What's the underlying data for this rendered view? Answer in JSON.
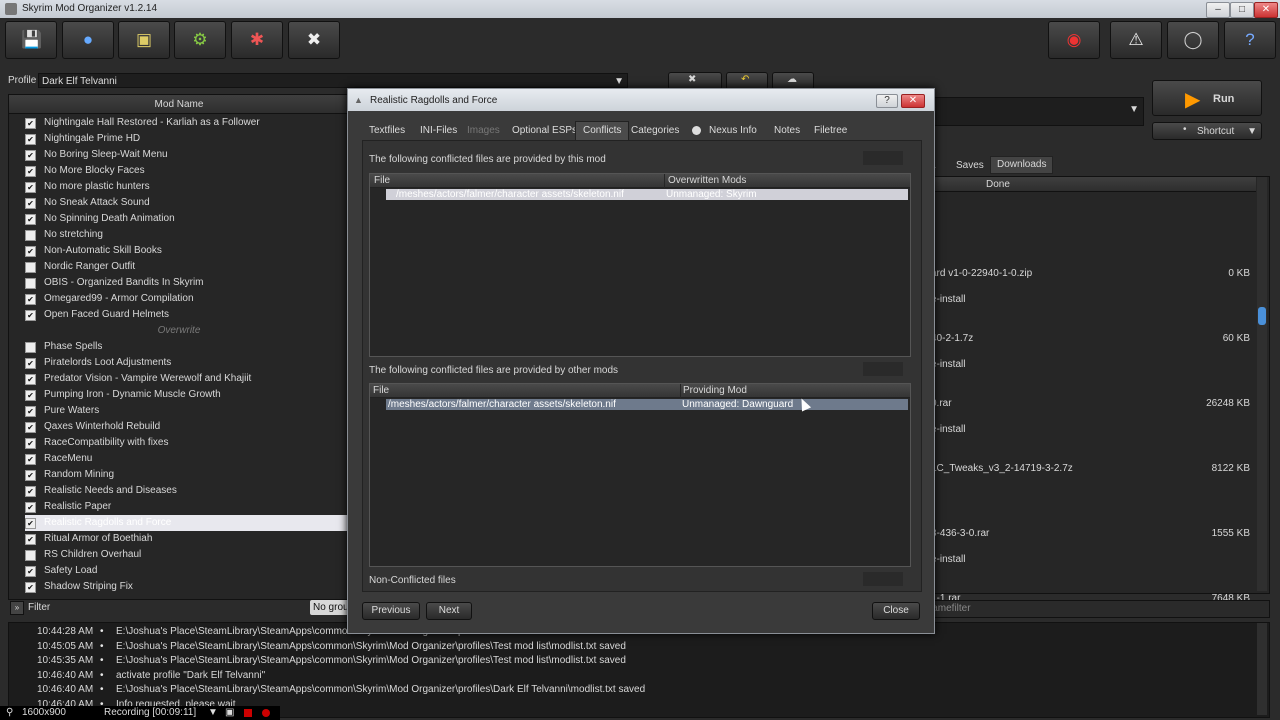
{
  "window": {
    "title": "Skyrim Mod Organizer v1.2.14"
  },
  "toolbar": {
    "buttons": [
      {
        "icon": "install-mod-icon"
      },
      {
        "icon": "nexus-icon"
      },
      {
        "icon": "profiles-icon"
      },
      {
        "icon": "executables-icon"
      },
      {
        "icon": "tools-icon"
      },
      {
        "icon": "settings-icon"
      }
    ],
    "right_buttons": [
      {
        "icon": "spider-icon"
      },
      {
        "icon": "warning-icon"
      },
      {
        "icon": "update-icon"
      },
      {
        "icon": "help-icon"
      }
    ]
  },
  "profile": {
    "label": "Profile",
    "value": "Dark Elf Telvanni"
  },
  "modlist": {
    "header": "Mod Name",
    "rows": [
      {
        "name": "Nightingale Hall Restored - Karliah as a Follower",
        "checked": true
      },
      {
        "name": "Nightingale Prime HD",
        "checked": true
      },
      {
        "name": "No Boring Sleep-Wait Menu",
        "checked": true
      },
      {
        "name": "No More Blocky Faces",
        "checked": true
      },
      {
        "name": "No more plastic hunters",
        "checked": true
      },
      {
        "name": "No Sneak Attack Sound",
        "checked": true
      },
      {
        "name": "No Spinning Death Animation",
        "checked": true
      },
      {
        "name": "No stretching",
        "checked": false
      },
      {
        "name": "Non-Automatic Skill Books",
        "checked": true
      },
      {
        "name": "Nordic Ranger Outfit",
        "checked": false
      },
      {
        "name": "OBIS - Organized Bandits In Skyrim",
        "checked": false
      },
      {
        "name": "Omegared99 - Armor Compilation",
        "checked": true
      },
      {
        "name": "Open Faced Guard Helmets",
        "checked": true
      },
      {
        "name": "Overwrite",
        "separator": true
      },
      {
        "name": "Phase Spells",
        "checked": false
      },
      {
        "name": "Piratelords Loot Adjustments",
        "checked": true
      },
      {
        "name": "Predator Vision - Vampire Werewolf and Khajiit",
        "checked": true
      },
      {
        "name": "Pumping Iron - Dynamic Muscle Growth",
        "checked": true
      },
      {
        "name": "Pure Waters",
        "checked": true
      },
      {
        "name": "Qaxes Winterhold Rebuild",
        "checked": true
      },
      {
        "name": "RaceCompatibility with fixes",
        "checked": true
      },
      {
        "name": "RaceMenu",
        "checked": true
      },
      {
        "name": "Random Mining",
        "checked": true
      },
      {
        "name": "Realistic Needs and Diseases",
        "checked": true
      },
      {
        "name": "Realistic Paper",
        "checked": true
      },
      {
        "name": "Realistic Ragdolls and Force",
        "checked": true,
        "selected": true
      },
      {
        "name": "Ritual Armor of Boethiah",
        "checked": true
      },
      {
        "name": "RS Children Overhaul",
        "checked": false
      },
      {
        "name": "Safety Load",
        "checked": true
      },
      {
        "name": "Shadow Striping Fix",
        "checked": true
      }
    ],
    "filter_label": "Filter",
    "group_label": "No group"
  },
  "right": {
    "run_label": "Run",
    "shortcut_label": "Shortcut",
    "tabs": [
      "a",
      "Saves",
      "Downloads"
    ],
    "dl_header_done": "Done",
    "downloads": [
      {
        "line1": "",
        "line2": "ll",
        "size": ""
      },
      {
        "line1": "ard v1-0-22940-1-0.zip",
        "line2": "e-install",
        "size": "0 KB"
      },
      {
        "line1": "40-2-1.7z",
        "line2": "e-install",
        "size": "60 KB"
      },
      {
        "line1": "0.rar",
        "line2": "e-install",
        "size": "26248 KB"
      },
      {
        "line1": "LC_Tweaks_v3_2-14719-3-2.7z",
        "line2": "ll",
        "size": "8122 KB"
      },
      {
        "line1": "3-436-3-0.rar",
        "line2": "e-install",
        "size": "1555 KB"
      },
      {
        "line1": "1-1.rar",
        "line2": "",
        "size": "7648 KB"
      }
    ],
    "namefilter": "Namefilter"
  },
  "log": [
    {
      "time": "10:44:28 AM",
      "msg": "E:\\Joshua's Place\\SteamLibrary\\SteamApps\\common\\Skyrim\\Mod Organizer\\profiles\\Test mod list\\modlist.txt saved"
    },
    {
      "time": "10:45:05 AM",
      "msg": "E:\\Joshua's Place\\SteamLibrary\\SteamApps\\common\\Skyrim\\Mod Organizer\\profiles\\Test mod list\\modlist.txt saved"
    },
    {
      "time": "10:45:35 AM",
      "msg": "E:\\Joshua's Place\\SteamLibrary\\SteamApps\\common\\Skyrim\\Mod Organizer\\profiles\\Test mod list\\modlist.txt saved"
    },
    {
      "time": "10:46:40 AM",
      "msg": "activate profile \"Dark Elf Telvanni\""
    },
    {
      "time": "10:46:40 AM",
      "msg": "E:\\Joshua's Place\\SteamLibrary\\SteamApps\\common\\Skyrim\\Mod Organizer\\profiles\\Dark Elf Telvanni\\modlist.txt saved"
    },
    {
      "time": "10:46:40 AM",
      "msg": "Info requested, please wait"
    }
  ],
  "recording": {
    "resolution": "1600x900",
    "status": "Recording [00:09:11]"
  },
  "dialog": {
    "title": "Realistic Ragdolls and Force",
    "tabs": [
      {
        "label": "Textfiles",
        "state": "normal"
      },
      {
        "label": "INI-Files",
        "state": "normal"
      },
      {
        "label": "Images",
        "state": "disabled"
      },
      {
        "label": "Optional ESPs",
        "state": "normal"
      },
      {
        "label": "Conflicts",
        "state": "active"
      },
      {
        "label": "Categories",
        "state": "normal"
      },
      {
        "label": "Nexus Info",
        "state": "normal"
      },
      {
        "label": "Notes",
        "state": "normal"
      },
      {
        "label": "Filetree",
        "state": "normal"
      }
    ],
    "section1_label": "The following conflicted files are provided by this mod",
    "table1": {
      "col_file": "File",
      "col_other": "Overwritten Mods",
      "rows": [
        {
          "file": "/meshes/actors/falmer/character assets/skeleton.nif",
          "other": "Unmanaged: Skyrim"
        }
      ]
    },
    "section2_label": "The following conflicted files are provided by other mods",
    "table2": {
      "col_file": "File",
      "col_other": "Providing Mod",
      "rows": [
        {
          "file": "/meshes/actors/falmer/character assets/skeleton.nif",
          "other": "Unmanaged: Dawnguard"
        }
      ]
    },
    "nonconflicted_label": "Non-Conflicted files",
    "previous_label": "Previous",
    "next_label": "Next",
    "close_label": "Close"
  }
}
